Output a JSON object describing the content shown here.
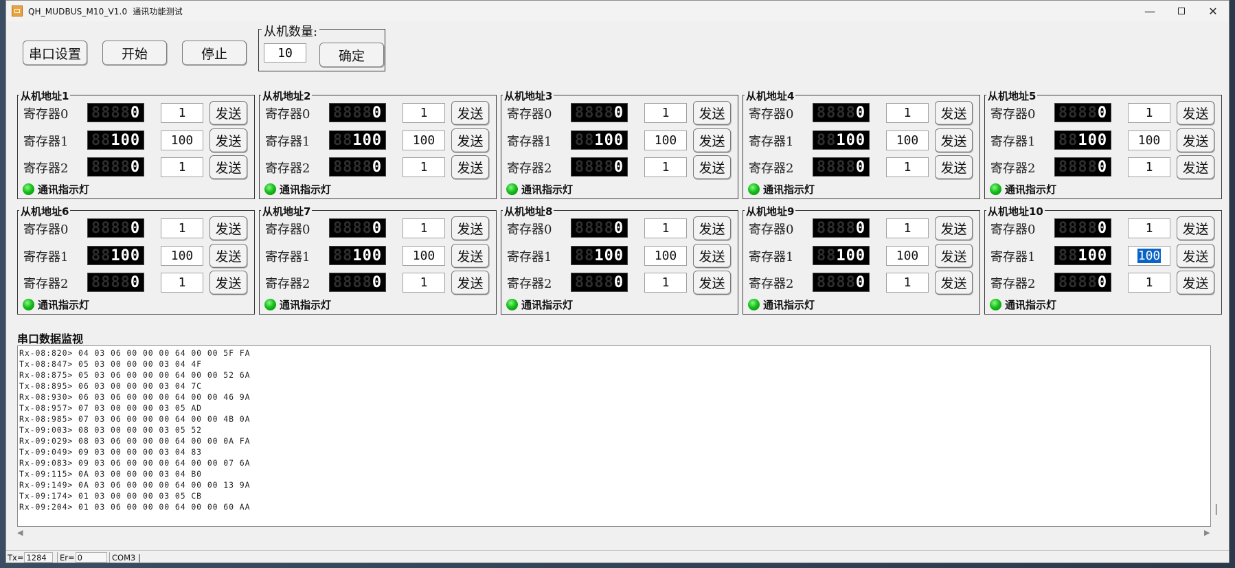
{
  "window": {
    "title_app": "QH_MUDBUS_M10_V1.0",
    "title_sub": "通讯功能测试",
    "minimize_glyph": "—",
    "close_glyph": "✕"
  },
  "toolbar": {
    "serial_settings": "串口设置",
    "start": "开始",
    "stop": "停止"
  },
  "slave_count": {
    "legend": "从机数量:",
    "value": "10",
    "confirm": "确定"
  },
  "common": {
    "reg_labels": [
      "寄存器0",
      "寄存器1",
      "寄存器2"
    ],
    "send": "发送",
    "led_label": "通讯指示灯"
  },
  "slaves": [
    {
      "title": "从机地址1",
      "inputs": [
        "1",
        "100",
        "1"
      ],
      "disp": [
        [
          "8888",
          "0"
        ],
        [
          "88",
          "100"
        ],
        [
          "8888",
          "0"
        ]
      ]
    },
    {
      "title": "从机地址2",
      "inputs": [
        "1",
        "100",
        "1"
      ],
      "disp": [
        [
          "8888",
          "0"
        ],
        [
          "88",
          "100"
        ],
        [
          "8888",
          "0"
        ]
      ]
    },
    {
      "title": "从机地址3",
      "inputs": [
        "1",
        "100",
        "1"
      ],
      "disp": [
        [
          "8888",
          "0"
        ],
        [
          "88",
          "100"
        ],
        [
          "8888",
          "0"
        ]
      ]
    },
    {
      "title": "从机地址4",
      "inputs": [
        "1",
        "100",
        "1"
      ],
      "disp": [
        [
          "8888",
          "0"
        ],
        [
          "88",
          "100"
        ],
        [
          "8888",
          "0"
        ]
      ]
    },
    {
      "title": "从机地址5",
      "inputs": [
        "1",
        "100",
        "1"
      ],
      "disp": [
        [
          "8888",
          "0"
        ],
        [
          "88",
          "100"
        ],
        [
          "8888",
          "0"
        ]
      ]
    },
    {
      "title": "从机地址6",
      "inputs": [
        "1",
        "100",
        "1"
      ],
      "disp": [
        [
          "8888",
          "0"
        ],
        [
          "88",
          "100"
        ],
        [
          "8888",
          "0"
        ]
      ]
    },
    {
      "title": "从机地址7",
      "inputs": [
        "1",
        "100",
        "1"
      ],
      "disp": [
        [
          "8888",
          "0"
        ],
        [
          "88",
          "100"
        ],
        [
          "8888",
          "0"
        ]
      ]
    },
    {
      "title": "从机地址8",
      "inputs": [
        "1",
        "100",
        "1"
      ],
      "disp": [
        [
          "8888",
          "0"
        ],
        [
          "88",
          "100"
        ],
        [
          "8888",
          "0"
        ]
      ]
    },
    {
      "title": "从机地址9",
      "inputs": [
        "1",
        "100",
        "1"
      ],
      "disp": [
        [
          "8888",
          "0"
        ],
        [
          "88",
          "100"
        ],
        [
          "8888",
          "0"
        ]
      ]
    },
    {
      "title": "从机地址10",
      "inputs": [
        "1",
        "100",
        "1"
      ],
      "disp": [
        [
          "8888",
          "0"
        ],
        [
          "88",
          "100"
        ],
        [
          "8888",
          "0"
        ]
      ],
      "selected_input": 1
    }
  ],
  "monitor": {
    "label": "串口数据监视",
    "lines": [
      "Rx-08:820> 04 03 06 00 00 00 64 00 00 5F FA",
      "Tx-08:847> 05 03 00 00 00 03 04 4F",
      "Rx-08:875> 05 03 06 00 00 00 64 00 00 52 6A",
      "Tx-08:895> 06 03 00 00 00 03 04 7C",
      "Rx-08:930> 06 03 06 00 00 00 64 00 00 46 9A",
      "Tx-08:957> 07 03 00 00 00 03 05 AD",
      "Rx-08:985> 07 03 06 00 00 00 64 00 00 4B 0A",
      "Tx-09:003> 08 03 00 00 00 03 05 52",
      "Rx-09:029> 08 03 06 00 00 00 64 00 00 0A FA",
      "Tx-09:049> 09 03 00 00 00 03 04 83",
      "Rx-09:083> 09 03 06 00 00 00 64 00 00 07 6A",
      "Tx-09:115> 0A 03 00 00 00 03 04 B0",
      "Rx-09:149> 0A 03 06 00 00 00 64 00 00 13 9A",
      "Tx-09:174> 01 03 00 00 00 03 05 CB",
      "Rx-09:204> 01 03 06 00 00 00 64 00 00 60 AA"
    ]
  },
  "statusbar": {
    "tx_label": "Tx=",
    "tx_value": "1284",
    "er_label": "Er=",
    "er_value": "0",
    "port": "COM3"
  },
  "icons": {
    "app": "app-icon",
    "minimize": "minimize-icon",
    "maximize": "maximize-icon",
    "close": "close-icon",
    "led": "led-indicator-icon",
    "scroll_left": "scroll-left-icon",
    "scroll_right": "scroll-right-icon"
  },
  "colors": {
    "led_green": "#16c21a",
    "segment_bg": "#000000",
    "selection": "#0a64c8"
  }
}
